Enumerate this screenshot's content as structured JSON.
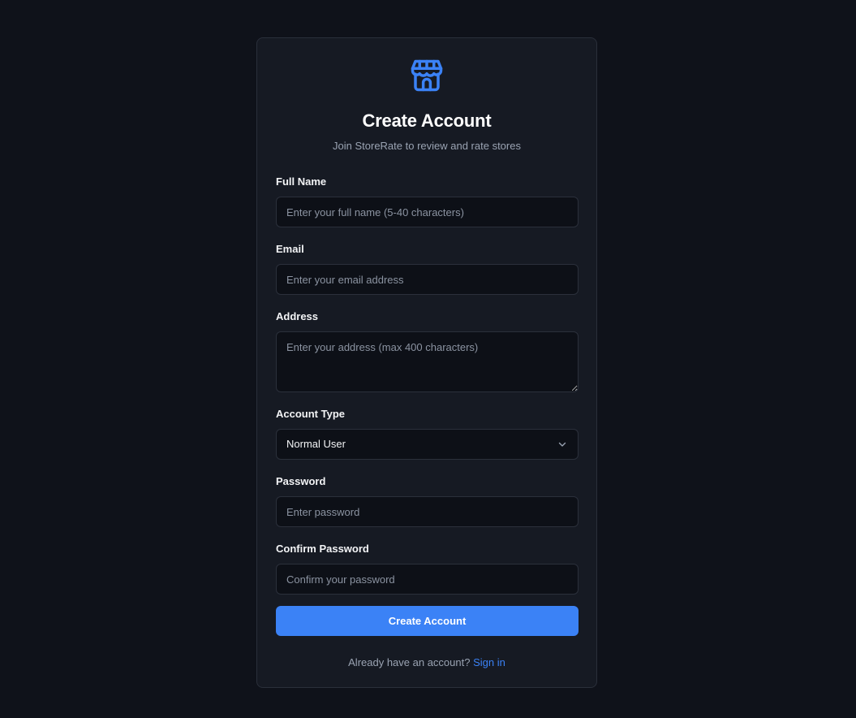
{
  "header": {
    "logo_icon": "store-icon",
    "title": "Create Account",
    "subtitle": "Join StoreRate to review and rate stores"
  },
  "form": {
    "full_name": {
      "label": "Full Name",
      "placeholder": "Enter your full name (5-40 characters)",
      "value": ""
    },
    "email": {
      "label": "Email",
      "placeholder": "Enter your email address",
      "value": ""
    },
    "address": {
      "label": "Address",
      "placeholder": "Enter your address (max 400 characters)",
      "value": ""
    },
    "account_type": {
      "label": "Account Type",
      "selected": "Normal User",
      "icon": "chevron-down-icon"
    },
    "password": {
      "label": "Password",
      "placeholder": "Enter password",
      "value": ""
    },
    "confirm_password": {
      "label": "Confirm Password",
      "placeholder": "Confirm your password",
      "value": ""
    },
    "submit_label": "Create Account"
  },
  "footer": {
    "prompt": "Already have an account?",
    "link_label": "Sign in"
  },
  "colors": {
    "background": "#0f121a",
    "card": "#161a23",
    "accent": "#3b82f6",
    "input_bg": "#0d1017",
    "border": "#2b303b"
  }
}
